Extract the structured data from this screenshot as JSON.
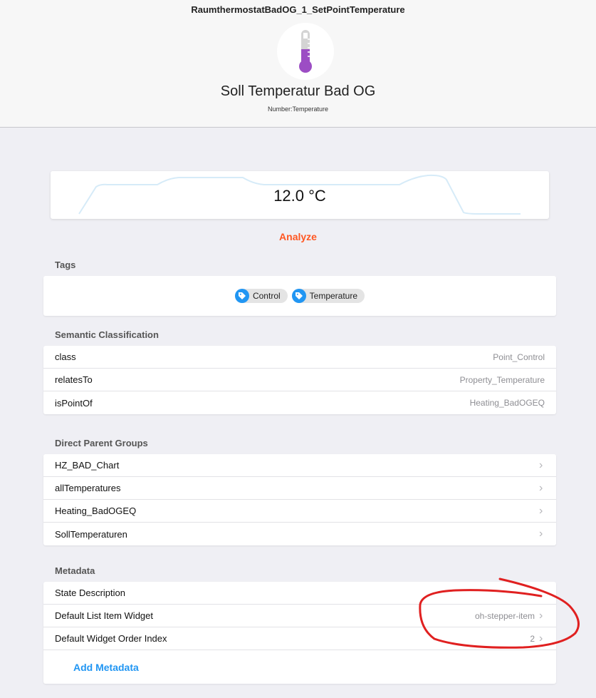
{
  "header": {
    "item_name": "RaumthermostatBadOG_1_SetPointTemperature",
    "label": "Soll Temperatur Bad OG",
    "type": "Number:Temperature",
    "icon": "thermometer-icon"
  },
  "state": {
    "value": "12.0 °C"
  },
  "analyze_label": "Analyze",
  "tags": {
    "title": "Tags",
    "items": [
      "Control",
      "Temperature"
    ]
  },
  "semantic": {
    "title": "Semantic Classification",
    "rows": [
      {
        "label": "class",
        "value": "Point_Control"
      },
      {
        "label": "relatesTo",
        "value": "Property_Temperature"
      },
      {
        "label": "isPointOf",
        "value": "Heating_BadOGEQ"
      }
    ]
  },
  "groups": {
    "title": "Direct Parent Groups",
    "items": [
      "HZ_BAD_Chart",
      "allTemperatures",
      "Heating_BadOGEQ",
      "SollTemperaturen"
    ]
  },
  "metadata": {
    "title": "Metadata",
    "rows": [
      {
        "label": "State Description",
        "value": ""
      },
      {
        "label": "Default List Item Widget",
        "value": "oh-stepper-item"
      },
      {
        "label": "Default Widget Order Index",
        "value": "2"
      }
    ],
    "add_label": "Add Metadata"
  },
  "colors": {
    "accent_orange": "#ff5722",
    "accent_blue": "#2196f3",
    "thermometer_purple": "#9c4dc4",
    "annotation_red": "#e02020"
  }
}
